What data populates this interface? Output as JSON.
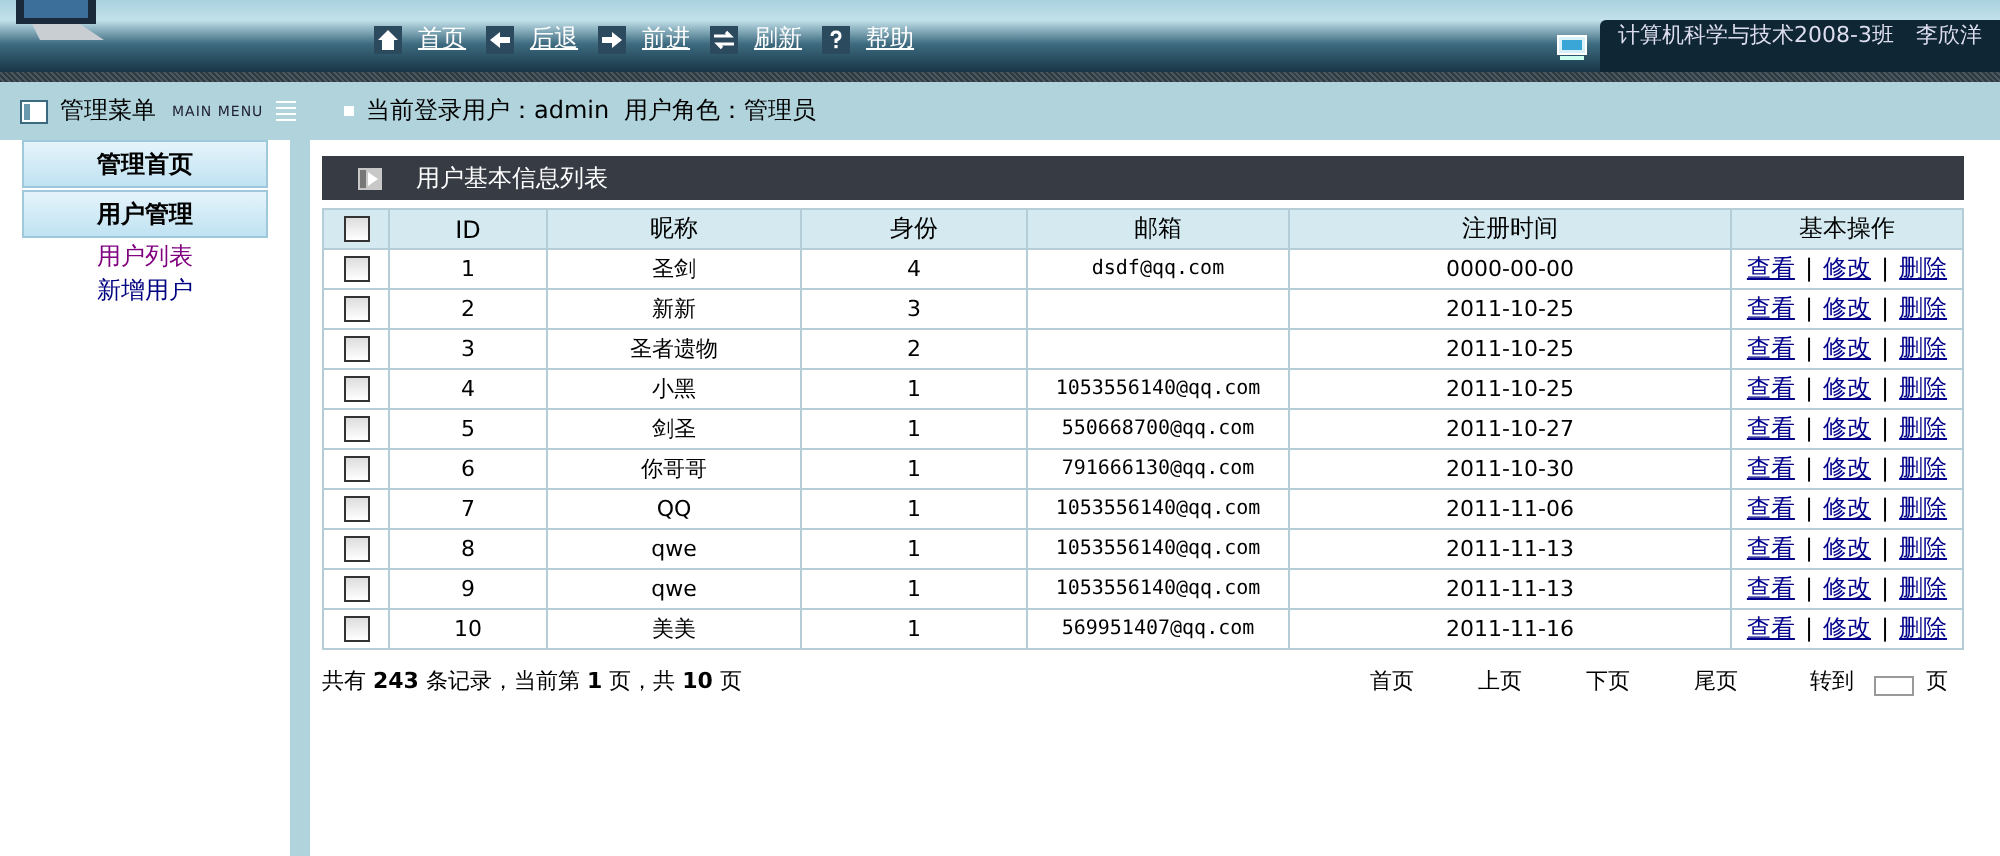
{
  "header": {
    "nav": [
      {
        "kind": "home",
        "label": "首页"
      },
      {
        "kind": "back",
        "label": "后退"
      },
      {
        "kind": "forward",
        "label": "前进"
      },
      {
        "kind": "refresh",
        "label": "刷新"
      },
      {
        "kind": "help",
        "label": "帮助"
      }
    ],
    "banner": "计算机科学与技术2008-3班　李欣洋"
  },
  "menu_bar": {
    "title": "管理菜单",
    "subtitle": "MAIN MENU",
    "user_label": "当前登录用户：",
    "user": "admin",
    "role_label": "用户角色：",
    "role": "管理员"
  },
  "sidebar": {
    "items": [
      {
        "kind": "section",
        "label": "管理首页"
      },
      {
        "kind": "section",
        "label": "用户管理"
      },
      {
        "kind": "link",
        "label": "用户列表",
        "selected": true
      },
      {
        "kind": "link",
        "label": "新增用户",
        "selected": false
      }
    ]
  },
  "table": {
    "title": "用户基本信息列表",
    "select_all": {
      "checked": false
    },
    "columns": [
      "ID",
      "昵称",
      "身份",
      "邮箱",
      "注册时间",
      "基本操作"
    ],
    "rows": [
      {
        "checked": false,
        "cells": [
          "1",
          "圣剑",
          "4",
          "dsdf@qq.com",
          "0000-00-00"
        ],
        "actions": [
          "查看",
          "|",
          "修改",
          "|",
          "删除"
        ]
      },
      {
        "checked": false,
        "cells": [
          "2",
          "新新",
          "3",
          "",
          "2011-10-25"
        ],
        "actions": [
          "查看",
          "|",
          "修改",
          "|",
          "删除"
        ]
      },
      {
        "checked": false,
        "cells": [
          "3",
          "圣者遗物",
          "2",
          "",
          "2011-10-25"
        ],
        "actions": [
          "查看",
          "|",
          "修改",
          "|",
          "删除"
        ]
      },
      {
        "checked": false,
        "cells": [
          "4",
          "小黑",
          "1",
          "1053556140@qq.com",
          "2011-10-25"
        ],
        "actions": [
          "查看",
          "|",
          "修改",
          "|",
          "删除"
        ]
      },
      {
        "checked": false,
        "cells": [
          "5",
          "剑圣",
          "1",
          "550668700@qq.com",
          "2011-10-27"
        ],
        "actions": [
          "查看",
          "|",
          "修改",
          "|",
          "删除"
        ]
      },
      {
        "checked": false,
        "cells": [
          "6",
          "你哥哥",
          "1",
          "791666130@qq.com",
          "2011-10-30"
        ],
        "actions": [
          "查看",
          "|",
          "修改",
          "|",
          "删除"
        ]
      },
      {
        "checked": false,
        "cells": [
          "7",
          "QQ",
          "1",
          "1053556140@qq.com",
          "2011-11-06"
        ],
        "actions": [
          "查看",
          "|",
          "修改",
          "|",
          "删除"
        ]
      },
      {
        "checked": false,
        "cells": [
          "8",
          "qwe",
          "1",
          "1053556140@qq.com",
          "2011-11-13"
        ],
        "actions": [
          "查看",
          "|",
          "修改",
          "|",
          "删除"
        ]
      },
      {
        "checked": false,
        "cells": [
          "9",
          "qwe",
          "1",
          "1053556140@qq.com",
          "2011-11-13"
        ],
        "actions": [
          "查看",
          "|",
          "修改",
          "|",
          "删除"
        ]
      },
      {
        "checked": false,
        "cells": [
          "10",
          "美美",
          "1",
          "569951407@qq.com",
          "2011-11-16"
        ],
        "actions": [
          "查看",
          "|",
          "修改",
          "|",
          "删除"
        ]
      }
    ]
  },
  "pagination": {
    "summary": "共有 **243** 条记录，当前第 **1** 页，共 **10** 页",
    "links": [
      "首页",
      "上页",
      "下页",
      "尾页"
    ],
    "goto_label": "转到",
    "goto_unit": "页"
  }
}
